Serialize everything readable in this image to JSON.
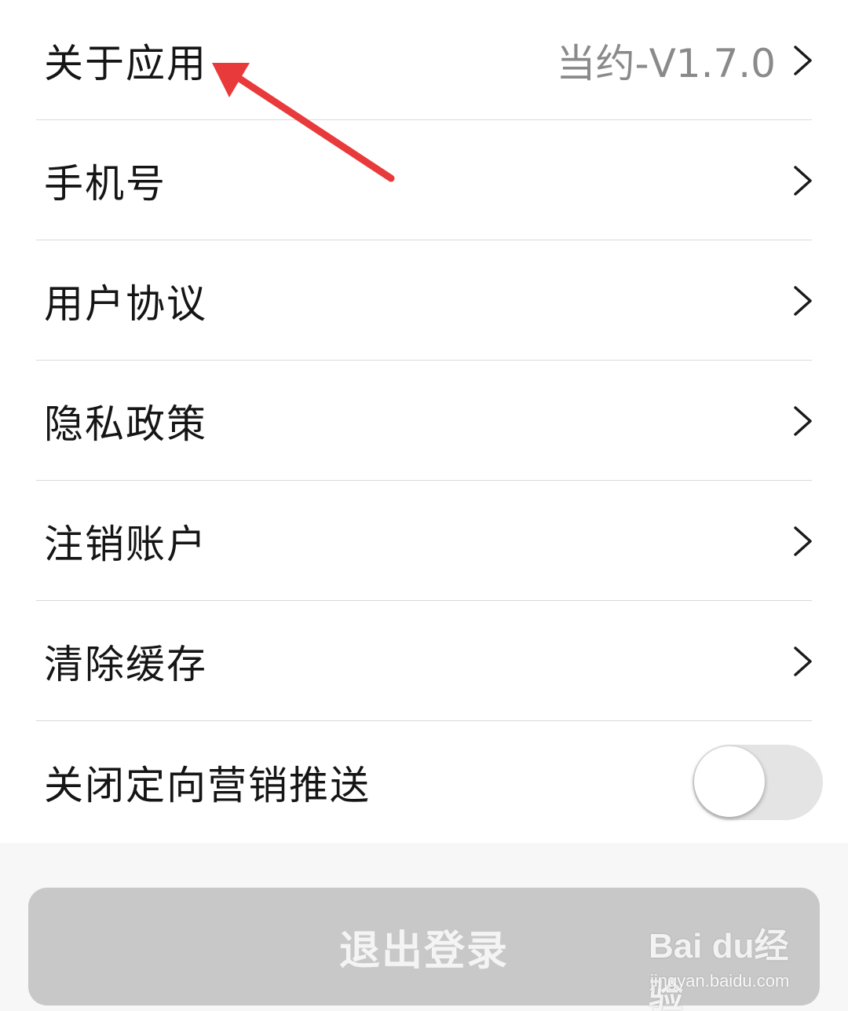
{
  "settings": {
    "items": [
      {
        "label": "关于应用",
        "value": "当约-V1.7.0"
      },
      {
        "label": "手机号"
      },
      {
        "label": "用户协议"
      },
      {
        "label": "隐私政策"
      },
      {
        "label": "注销账户"
      },
      {
        "label": "清除缓存"
      }
    ],
    "toggle": {
      "label": "关闭定向营销推送",
      "on": false
    }
  },
  "logout_label": "退出登录",
  "annotation_arrow": {
    "color": "#e83a3a"
  },
  "watermark": {
    "brand": "Bai du经验",
    "url": "jingyan.baidu.com"
  },
  "icons": {
    "chevron": "chevron-right-icon"
  }
}
